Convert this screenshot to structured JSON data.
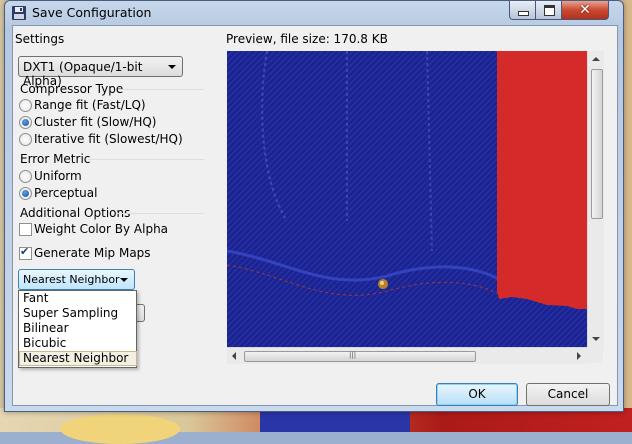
{
  "window": {
    "title": "Save Configuration"
  },
  "settings": {
    "heading": "Settings",
    "format_value": "DXT1 (Opaque/1-bit Alpha)",
    "compressor_type_label": "Compressor Type",
    "compressor_options": [
      "Range fit (Fast/LQ)",
      "Cluster fit (Slow/HQ)",
      "Iterative fit (Slowest/HQ)"
    ],
    "compressor_selected": "Cluster fit (Slow/HQ)",
    "error_metric_label": "Error Metric",
    "error_metric_options": [
      "Uniform",
      "Perceptual"
    ],
    "error_metric_selected": "Perceptual",
    "additional_options_label": "Additional Options",
    "weight_color_label": "Weight Color By Alpha",
    "weight_color_checked": false,
    "generate_mip_label": "Generate Mip Maps",
    "generate_mip_checked": true,
    "resampling_value": "Nearest Neighbor",
    "resampling_options": [
      "Fant",
      "Super Sampling",
      "Bilinear",
      "Bicubic",
      "Nearest Neighbor"
    ]
  },
  "preview": {
    "label": "Preview, file size: 170.8 KB"
  },
  "buttons": {
    "ok": "OK",
    "cancel": "Cancel"
  },
  "colors": {
    "preview_blue": "#1c2494",
    "preview_red": "#d42a2a",
    "accent": "#3c7fb1"
  }
}
